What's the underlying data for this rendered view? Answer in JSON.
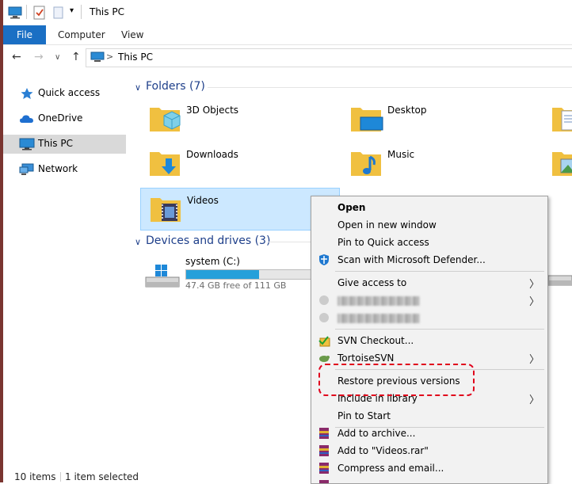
{
  "window": {
    "title": "This PC"
  },
  "ribbon": {
    "tabs": [
      "File",
      "Computer",
      "View"
    ]
  },
  "address": {
    "path": "This PC",
    "separator": ">"
  },
  "nav": {
    "items": [
      {
        "label": "Quick access",
        "icon": "star-icon"
      },
      {
        "label": "OneDrive",
        "icon": "cloud-icon"
      },
      {
        "label": "This PC",
        "icon": "monitor-icon",
        "selected": true
      },
      {
        "label": "Network",
        "icon": "network-icon"
      }
    ]
  },
  "folders": {
    "title": "Folders (7)",
    "items": [
      {
        "name": "3D Objects"
      },
      {
        "name": "Desktop"
      },
      {
        "name": "Downloads"
      },
      {
        "name": "Music"
      },
      {
        "name": "Videos",
        "selected": true
      }
    ]
  },
  "drives": {
    "title": "Devices and drives (3)",
    "items": [
      {
        "name": "system (C:)",
        "free_text": "47.4 GB free of 111 GB",
        "used_fraction": 0.573
      }
    ]
  },
  "context_menu": {
    "items": [
      {
        "label": "Open",
        "bold": true
      },
      {
        "label": "Open in new window"
      },
      {
        "label": "Pin to Quick access"
      },
      {
        "label": "Scan with Microsoft Defender...",
        "icon": "defender-icon"
      },
      {
        "label": "Give access to",
        "submenu": true
      },
      {
        "label": "",
        "blurred": true,
        "submenu": true
      },
      {
        "label": "",
        "blurred": true
      },
      {
        "label": "SVN Checkout...",
        "icon": "svn-checkout-icon"
      },
      {
        "label": "TortoiseSVN",
        "icon": "tortoisesvn-icon",
        "submenu": true
      },
      {
        "label": "Restore previous versions",
        "highlighted": true
      },
      {
        "label": "Include in library",
        "submenu": true
      },
      {
        "label": "Pin to Start"
      },
      {
        "label": "Add to archive...",
        "icon": "winrar-icon"
      },
      {
        "label": "Add to \"Videos.rar\"",
        "icon": "winrar-icon"
      },
      {
        "label": "Compress and email...",
        "icon": "winrar-icon"
      }
    ]
  },
  "status_bar": {
    "count": "10 items",
    "selection": "1 item selected"
  },
  "colors": {
    "accent": "#1a6fc4",
    "group_title": "#1e3f8a",
    "selection": "#cce8ff",
    "highlight_box": "#e0001b",
    "drive_fill": "#26a0da"
  }
}
